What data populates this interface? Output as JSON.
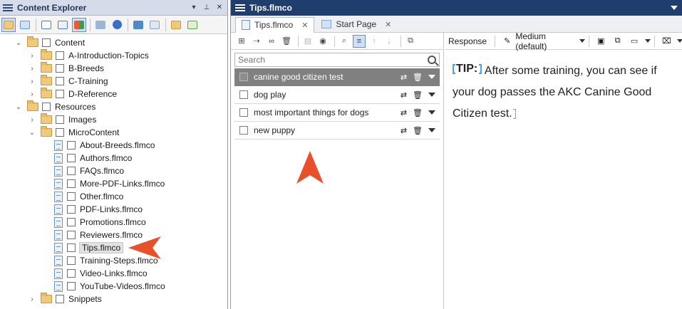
{
  "explorer": {
    "title": "Content Explorer",
    "tree": [
      {
        "label": "Content",
        "kind": "folder",
        "expanded": true
      },
      {
        "label": "A-Introduction-Topics",
        "kind": "folder",
        "expanded": false
      },
      {
        "label": "B-Breeds",
        "kind": "folder",
        "expanded": false
      },
      {
        "label": "C-Training",
        "kind": "folder",
        "expanded": false
      },
      {
        "label": "D-Reference",
        "kind": "folder",
        "expanded": false
      },
      {
        "label": "Resources",
        "kind": "folder",
        "expanded": true
      },
      {
        "label": "Images",
        "kind": "folder",
        "expanded": false
      },
      {
        "label": "MicroContent",
        "kind": "folder",
        "expanded": true
      },
      {
        "label": "About-Breeds.flmco",
        "kind": "file"
      },
      {
        "label": "Authors.flmco",
        "kind": "file"
      },
      {
        "label": "FAQs.flmco",
        "kind": "file"
      },
      {
        "label": "More-PDF-Links.flmco",
        "kind": "file"
      },
      {
        "label": "Other.flmco",
        "kind": "file"
      },
      {
        "label": "PDF-Links.flmco",
        "kind": "file"
      },
      {
        "label": "Promotions.flmco",
        "kind": "file"
      },
      {
        "label": "Reviewers.flmco",
        "kind": "file"
      },
      {
        "label": "Tips.flmco",
        "kind": "file",
        "selected": true
      },
      {
        "label": "Training-Steps.flmco",
        "kind": "file"
      },
      {
        "label": "Video-Links.flmco",
        "kind": "file"
      },
      {
        "label": "YouTube-Videos.flmco",
        "kind": "file"
      },
      {
        "label": "Snippets",
        "kind": "folder",
        "expanded": false
      }
    ]
  },
  "editor": {
    "window_title": "Tips.flmco",
    "tabs": [
      {
        "label": "Tips.flmco",
        "close": "✕"
      },
      {
        "label": "Start Page",
        "close": "✕"
      }
    ],
    "search": {
      "placeholder": "Search"
    },
    "phrases": [
      {
        "label": "canine good citizen test",
        "selected": true
      },
      {
        "label": "dog play"
      },
      {
        "label": "most important things for dogs"
      },
      {
        "label": "new puppy"
      }
    ],
    "response": {
      "label": "Response",
      "size_option": "Medium (default)",
      "tip_label": "TIP:",
      "text": "After some training, you can see if your dog passes the AKC Canine Good Citizen test."
    }
  },
  "colors": {
    "title_bar": "#1f3e6e",
    "selected_row": "#808080",
    "annotation_arrow": "#e8502a",
    "tag_bracket": "#4aa3e6"
  },
  "icons": [
    "hamburger-icon",
    "pin-icon",
    "close-icon",
    "folder-icon",
    "checkbox-icon",
    "document-icon",
    "search-icon",
    "delete-icon",
    "dropdown-icon",
    "arrow-up-icon",
    "arrow-down-icon"
  ]
}
